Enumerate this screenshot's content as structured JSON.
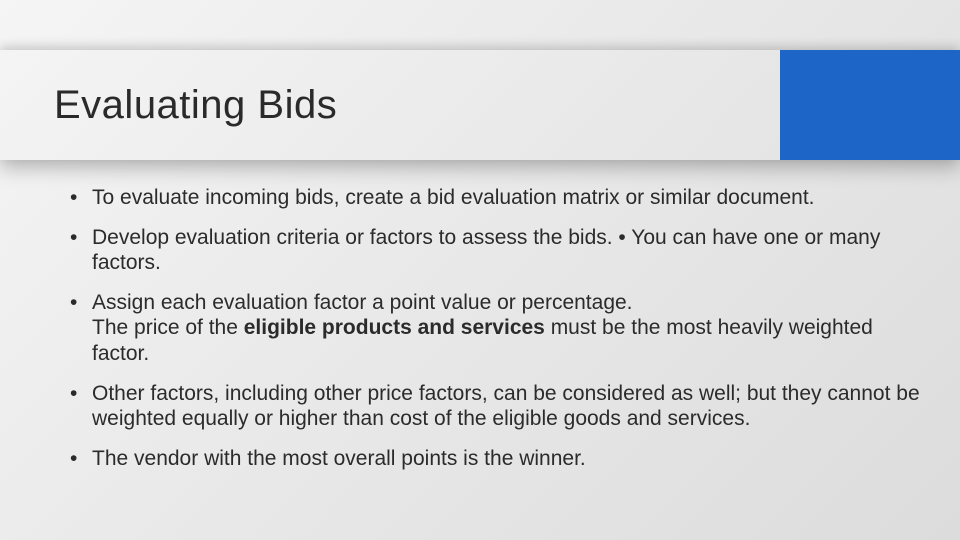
{
  "title": "Evaluating Bids",
  "bullets": {
    "b1": "To evaluate incoming bids, create a bid evaluation matrix or similar document.",
    "b2a": "Develop evaluation criteria or factors to assess the bids.",
    "b2b": "You can have one or many factors.",
    "b3a": "Assign each evaluation factor a point value or percentage.",
    "b3b_pre": "The price of the ",
    "b3b_bold": "eligible products and services",
    "b3b_post": " must be the most heavily weighted factor.",
    "b4": "Other factors, including other price factors, can be considered as well; but they cannot be weighted equally or higher than cost of the eligible goods and services.",
    "b5": "The vendor with the most overall points is the winner."
  }
}
